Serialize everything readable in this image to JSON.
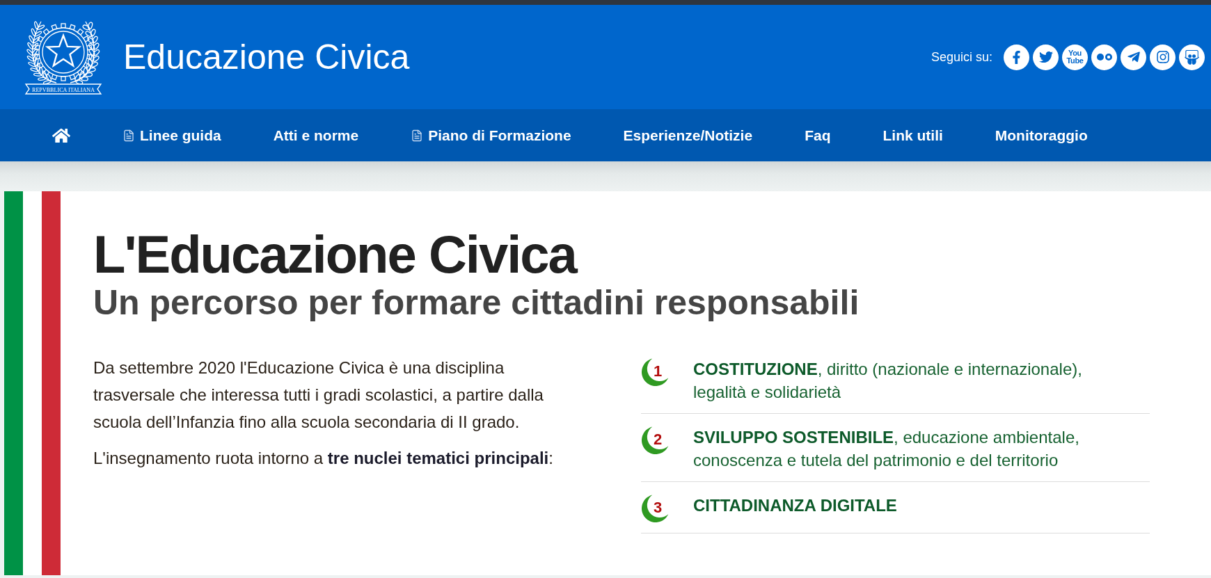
{
  "header": {
    "emblem": {
      "motto": "REPVBBLICA ITALIANA"
    },
    "title": "Educazione Civica",
    "social": {
      "label": "Seguici su:",
      "links": [
        {
          "kind": "facebook"
        },
        {
          "kind": "twitter"
        },
        {
          "kind": "youtube",
          "text": "You Tube"
        },
        {
          "kind": "flickr"
        },
        {
          "kind": "telegram"
        },
        {
          "kind": "instagram"
        },
        {
          "kind": "slideshare"
        }
      ]
    }
  },
  "nav": [
    {
      "kind": "home"
    },
    {
      "kind": "document",
      "label": "Linee guida"
    },
    {
      "kind": "plain",
      "label": "Atti e norme"
    },
    {
      "kind": "document",
      "label": "Piano di Formazione"
    },
    {
      "kind": "plain",
      "label": "Esperienze/Notizie"
    },
    {
      "kind": "plain",
      "label": "Faq"
    },
    {
      "kind": "plain",
      "label": "Link utili"
    },
    {
      "kind": "plain",
      "label": "Monitoraggio"
    }
  ],
  "hero": {
    "title": "L'Educazione Civica",
    "subtitle": "Un percorso per formare cittadini responsabili",
    "paragraphs": [
      "Da settembre 2020 l'Educazione Civica è una disciplina trasversale che interessa tutti i gradi scolastici, a partire dalla scuola dell’Infanzia fino alla scuola secondaria di II grado.",
      "L'insegnamento ruota intorno a **tre nuclei tematici principali**:"
    ],
    "themes": [
      {
        "number": "1",
        "title": "COSTITUZIONE",
        "detail": ", diritto (nazionale e internazionale), legalità e solidarietà"
      },
      {
        "number": "2",
        "title": "SVILUPPO SOSTENIBILE",
        "detail": ", educazione ambientale, conoscenza e tutela del patrimonio e del territorio"
      },
      {
        "number": "3",
        "title": "CITTADINANZA DIGITALE"
      }
    ]
  }
}
